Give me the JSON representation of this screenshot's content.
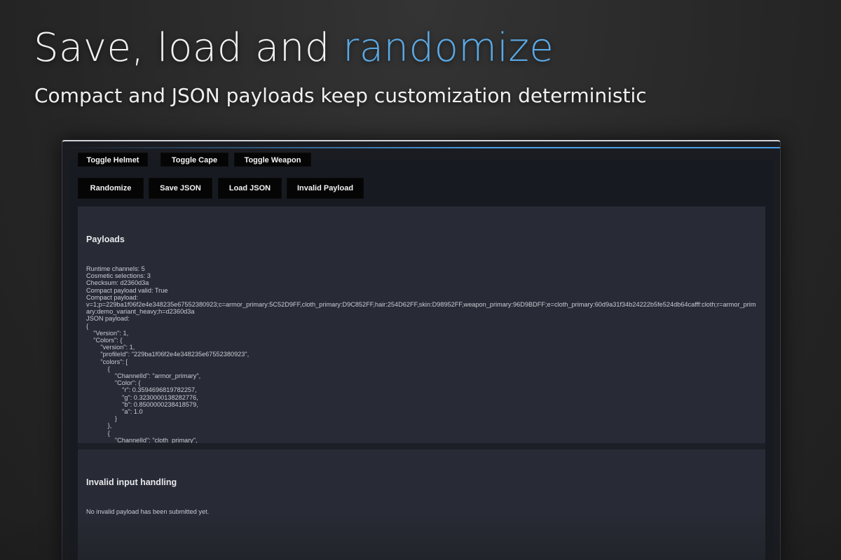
{
  "hero": {
    "title_main": "Save, load and ",
    "title_accent": "randomize",
    "subtitle": "Compact and JSON payloads keep customization deterministic"
  },
  "colors": {
    "accent": "#5aa9e6",
    "panel": "#282b35",
    "button": "#050505"
  },
  "toolbar_top": {
    "toggle_helmet": "Toggle Helmet",
    "toggle_cape": "Toggle Cape",
    "toggle_weapon": "Toggle Weapon"
  },
  "toolbar": {
    "randomize": "Randomize",
    "save_json": "Save JSON",
    "load_json": "Load JSON",
    "invalid_payload": "Invalid Payload"
  },
  "payloads": {
    "title": "Payloads",
    "text": "Runtime channels: 5\nCosmetic selections: 3\nChecksum: d2360d3a\nCompact payload valid: True\nCompact payload:\nv=1;p=229ba1f06f2e4e348235e67552380923;c=armor_primary:5C52D9FF,cloth_primary:D9C852FF,hair:254D62FF,skin:D98952FF,weapon_primary:96D9BDFF;e=cloth_primary:60d9a31f34b24222b5fe524db64cafff:cloth;r=armor_primary:demo_variant_heavy;h=d2360d3a\nJSON payload:\n{\n    \"Version\": 1,\n    \"Colors\": {\n        \"version\": 1,\n        \"profileId\": \"229ba1f06f2e4e348235e67552380923\",\n        \"colors\": [\n            {\n                \"ChannelId\": \"armor_primary\",\n                \"Color\": {\n                    \"r\": 0.3594696819782257,\n                    \"g\": 0.3230000138282776,\n                    \"b\": 0.8500000238418579,\n                    \"a\": 1.0\n                }\n            },\n            {\n                \"ChannelId\": \"cloth_primary\",\n                \"Color\": {"
  },
  "invalid": {
    "title": "Invalid input handling",
    "text": "No invalid payload has been submitted yet."
  }
}
